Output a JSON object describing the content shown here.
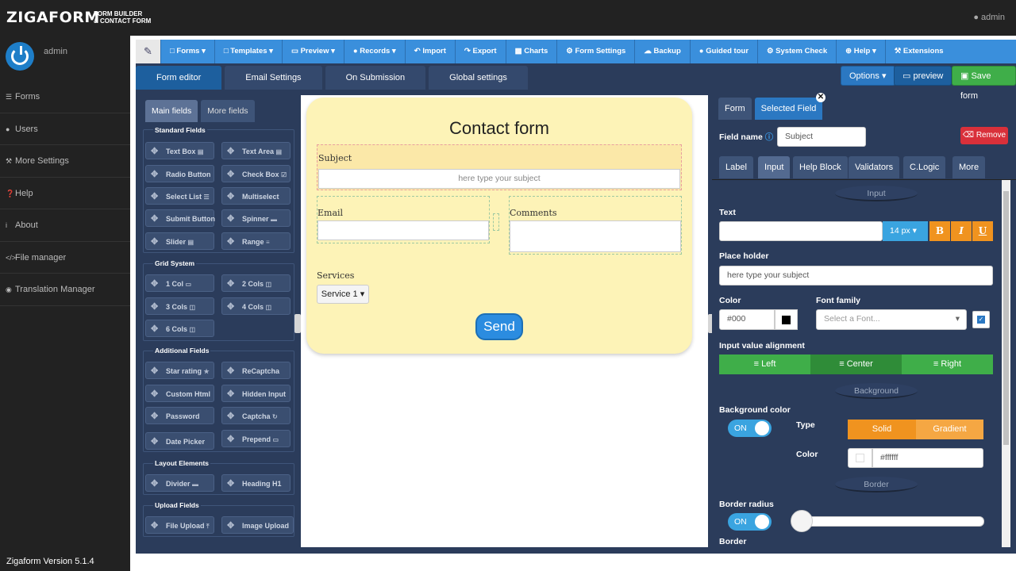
{
  "topbar": {
    "logo": "ZIGAFORM",
    "logo_sub1": "FORM BUILDER",
    "logo_sub2": "& CONTACT FORM",
    "user": "admin"
  },
  "sidebar": {
    "user": "admin",
    "items": [
      {
        "label": "Forms",
        "icon": "list-icon"
      },
      {
        "label": "Users",
        "icon": "user-icon"
      },
      {
        "label": "More Settings",
        "icon": "wrench-icon"
      },
      {
        "label": "Help",
        "icon": "question-icon"
      },
      {
        "label": "About",
        "icon": "info-icon"
      },
      {
        "label": "File manager",
        "icon": "code-icon"
      },
      {
        "label": "Translation Manager",
        "icon": "globe-icon"
      }
    ],
    "version": "Zigaform Version 5.1.4"
  },
  "toolbar": {
    "items": [
      {
        "label": "Forms ▾",
        "icon": "file-icon"
      },
      {
        "label": "Templates ▾",
        "icon": "file-icon"
      },
      {
        "label": "Preview ▾",
        "icon": "monitor-icon"
      },
      {
        "label": "Records ▾",
        "icon": "question-icon"
      },
      {
        "label": "Import",
        "icon": "undo-icon"
      },
      {
        "label": "Export",
        "icon": "share-icon"
      },
      {
        "label": "Charts",
        "icon": "chart-icon"
      },
      {
        "label": "Form Settings",
        "icon": "gear-icon"
      },
      {
        "label": "Backup",
        "icon": "cloud-icon"
      },
      {
        "label": "Guided tour",
        "icon": "question-icon"
      },
      {
        "label": "System Check",
        "icon": "gear-icon"
      },
      {
        "label": "Help ▾",
        "icon": "plus-icon"
      },
      {
        "label": "Extensions",
        "icon": "wrench-icon"
      }
    ]
  },
  "tabs": [
    "Form editor",
    "Email Settings",
    "On Submission",
    "Global settings"
  ],
  "actions": {
    "options": "Options ▾",
    "preview": "preview",
    "save": "Save form"
  },
  "left_panel": {
    "tabs": [
      "Main fields",
      "More fields"
    ],
    "groups": [
      {
        "title": "Standard Fields",
        "fields": [
          "Text Box",
          "Text Area",
          "Radio Button",
          "Check Box",
          "Select List",
          "Multiselect",
          "Submit Button",
          "Spinner",
          "Slider",
          "Range"
        ]
      },
      {
        "title": "Grid System",
        "fields": [
          "1 Col",
          "2 Cols",
          "3 Cols",
          "4 Cols",
          "6 Cols"
        ]
      },
      {
        "title": "Additional Fields",
        "fields": [
          "Star rating",
          "ReCaptcha",
          "Custom Html",
          "Hidden Input",
          "Password",
          "Captcha",
          "Date Picker",
          "Prepend"
        ]
      },
      {
        "title": "Layout Elements",
        "fields": [
          "Divider",
          "Heading H1"
        ]
      },
      {
        "title": "Upload Fields",
        "fields": [
          "File Upload",
          "Image Upload"
        ]
      }
    ]
  },
  "form": {
    "title": "Contact form",
    "subject_label": "Subject",
    "subject_placeholder": "here type your subject",
    "email_label": "Email",
    "comments_label": "Comments",
    "services_label": "Services",
    "service_value": "Service 1 ▾",
    "send": "Send"
  },
  "right_panel": {
    "tabs": [
      "Form",
      "Selected Field"
    ],
    "field_name_label": "Field name",
    "field_name_value": "Subject",
    "remove": "Remove",
    "subtabs": [
      "Label",
      "Input",
      "Help Block",
      "Validators",
      "C.Logic",
      "More"
    ],
    "section_input": "Input",
    "text_label": "Text",
    "font_size": "14 px",
    "bold": "B",
    "italic": "I",
    "underline": "U",
    "placeholder_label": "Place holder",
    "placeholder_value": "here type your subject",
    "color_label": "Color",
    "color_value": "#000",
    "font_family_label": "Font family",
    "font_family_placeholder": "Select a Font...",
    "alignment_label": "Input value alignment",
    "align_options": [
      "Left",
      "Center",
      "Right"
    ],
    "section_background": "Background",
    "bg_color_label": "Background color",
    "toggle_on": "ON",
    "type_label": "Type",
    "type_options": [
      "Solid",
      "Gradient"
    ],
    "bg_color_field_label": "Color",
    "bg_color_value": "#ffffff",
    "section_border": "Border",
    "border_radius_label": "Border radius",
    "border_label": "Border"
  },
  "colors": {
    "accent": "#3a8fdc",
    "success": "#3fae49",
    "danger": "#d9303a",
    "warning": "#f0931f"
  }
}
